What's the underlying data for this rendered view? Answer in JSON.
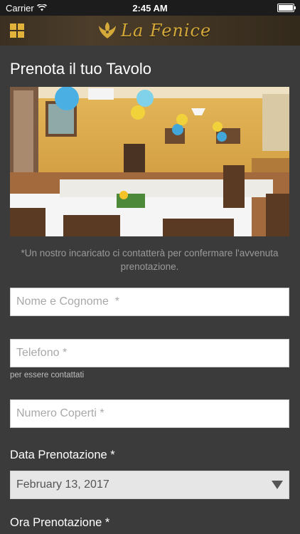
{
  "status_bar": {
    "carrier": "Carrier",
    "time": "2:45 AM"
  },
  "nav": {
    "brand": "La Fenice",
    "menu_icon": "grid-menu-icon",
    "accent": "#e2b33a"
  },
  "page": {
    "title": "Prenota il tuo Tavolo"
  },
  "photo": {
    "alt": "Sala ristorante"
  },
  "note": "*Un nostro incaricato ci contatterà per confermare l'avvenuta prenotazione.",
  "form": {
    "name": {
      "placeholder": "Nome e Cognome  *",
      "value": ""
    },
    "phone": {
      "placeholder": "Telefono *",
      "value": "",
      "hint": "per essere contattati"
    },
    "covers": {
      "placeholder": "Numero Coperti *",
      "value": ""
    },
    "date": {
      "label": "Data Prenotazione *",
      "value": "February 13, 2017"
    },
    "time": {
      "label": "Ora Prenotazione *"
    }
  }
}
